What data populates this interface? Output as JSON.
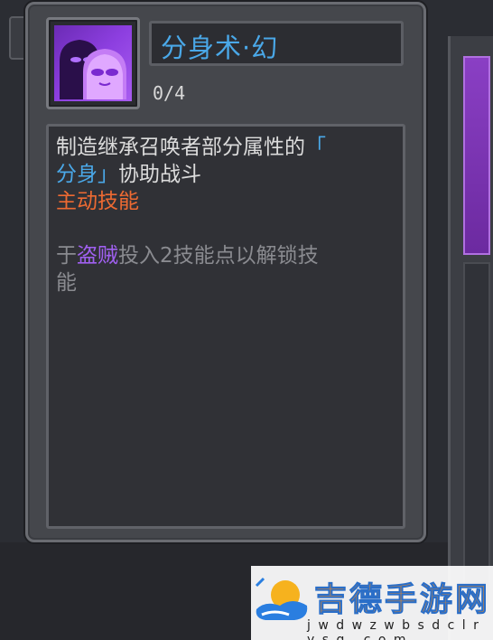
{
  "skill": {
    "title": "分身术·幻",
    "level": "0/4",
    "icon": "clone-shadow-icon"
  },
  "description": {
    "line1": "制造继承召唤者部分属性的",
    "line1_bracket": "「",
    "line2_bracket_text": "分身」",
    "line2_rest": "协助战斗",
    "skill_type": "主动技能",
    "unlock_prefix": "于",
    "unlock_class": "盗贼",
    "unlock_suffix": "投入2技能点以解锁技",
    "unlock_line2": "能"
  },
  "watermark": {
    "brand": "吉德手游网",
    "url": "j w d w z w b s d c l r y s g . c o m",
    "logo": "cloud-logo-icon"
  },
  "colors": {
    "title_blue": "#4aa8e8",
    "skill_type_orange": "#ee6a32",
    "class_purple": "#a060f0",
    "locked_grey": "#8a8b90",
    "icon_purple": "#8d3fe0"
  }
}
